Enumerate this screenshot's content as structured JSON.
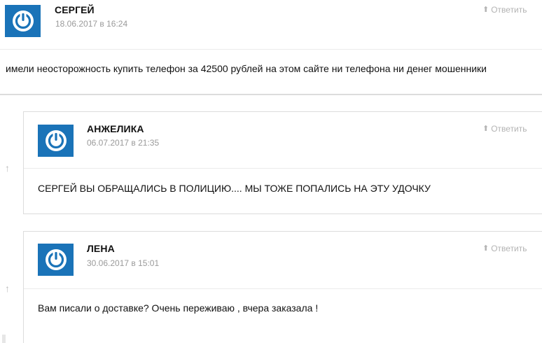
{
  "comments": [
    {
      "author": "СЕРГЕЙ",
      "date": "18.06.2017 в 16:24",
      "reply_label": "Ответить",
      "text": "имели неосторожность купить телефон за 42500 рублей на этом сайте ни телефона ни денег мошенники"
    }
  ],
  "replies": [
    {
      "author": "АНЖЕЛИКА",
      "date": "06.07.2017 в 21:35",
      "reply_label": "Ответить",
      "text": "СЕРГЕЙ ВЫ ОБРАЩАЛИСЬ В ПОЛИЦИЮ.... МЫ ТОЖЕ ПОПАЛИСЬ НА ЭТУ УДОЧКУ"
    },
    {
      "author": "ЛЕНА",
      "date": "30.06.2017 в 15:01",
      "reply_label": "Ответить",
      "text": "Вам писали о доставке? Очень переживаю , вчера заказала !"
    }
  ],
  "icons": {
    "avatar": "power-icon",
    "reply": "arrow-up-icon",
    "thread": "arrow-up-icon"
  },
  "colors": {
    "avatar_bg": "#1a73b8",
    "date": "#9a9a9a",
    "reply": "#b3b3b3",
    "border": "#dcdcdc"
  }
}
